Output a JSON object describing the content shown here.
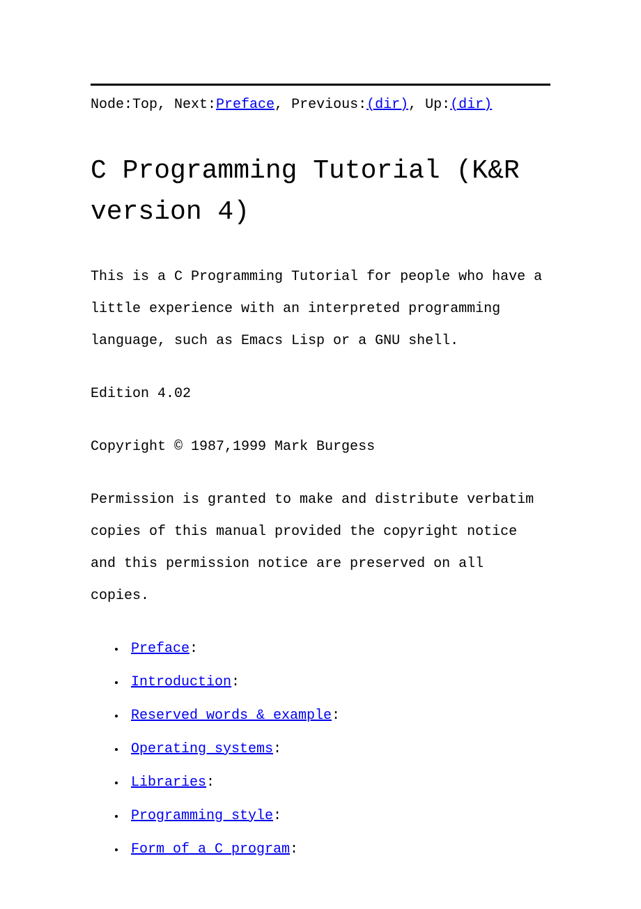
{
  "nav": {
    "node_label": "Node:",
    "node_value": "Top",
    "next_label": ", Next:",
    "next_link": "Preface",
    "previous_label": ", Previous:",
    "previous_link": "(dir)",
    "up_label": ", Up:",
    "up_link": "(dir)"
  },
  "title": "C Programming Tutorial (K&R version 4)",
  "intro": "This is a C Programming Tutorial for people who have a little experience with an interpreted programming language, such as Emacs Lisp or a GNU shell.",
  "edition": "Edition 4.02",
  "copyright": "Copyright © 1987,1999 Mark Burgess",
  "permission": "Permission is granted to make and distribute verbatim copies of this manual provided the copyright notice and this permission notice are preserved on all copies.",
  "toc": [
    "Preface",
    "Introduction",
    "Reserved words & example",
    "Operating systems",
    "Libraries",
    "Programming style",
    "Form of a C program"
  ],
  "colon": ":"
}
